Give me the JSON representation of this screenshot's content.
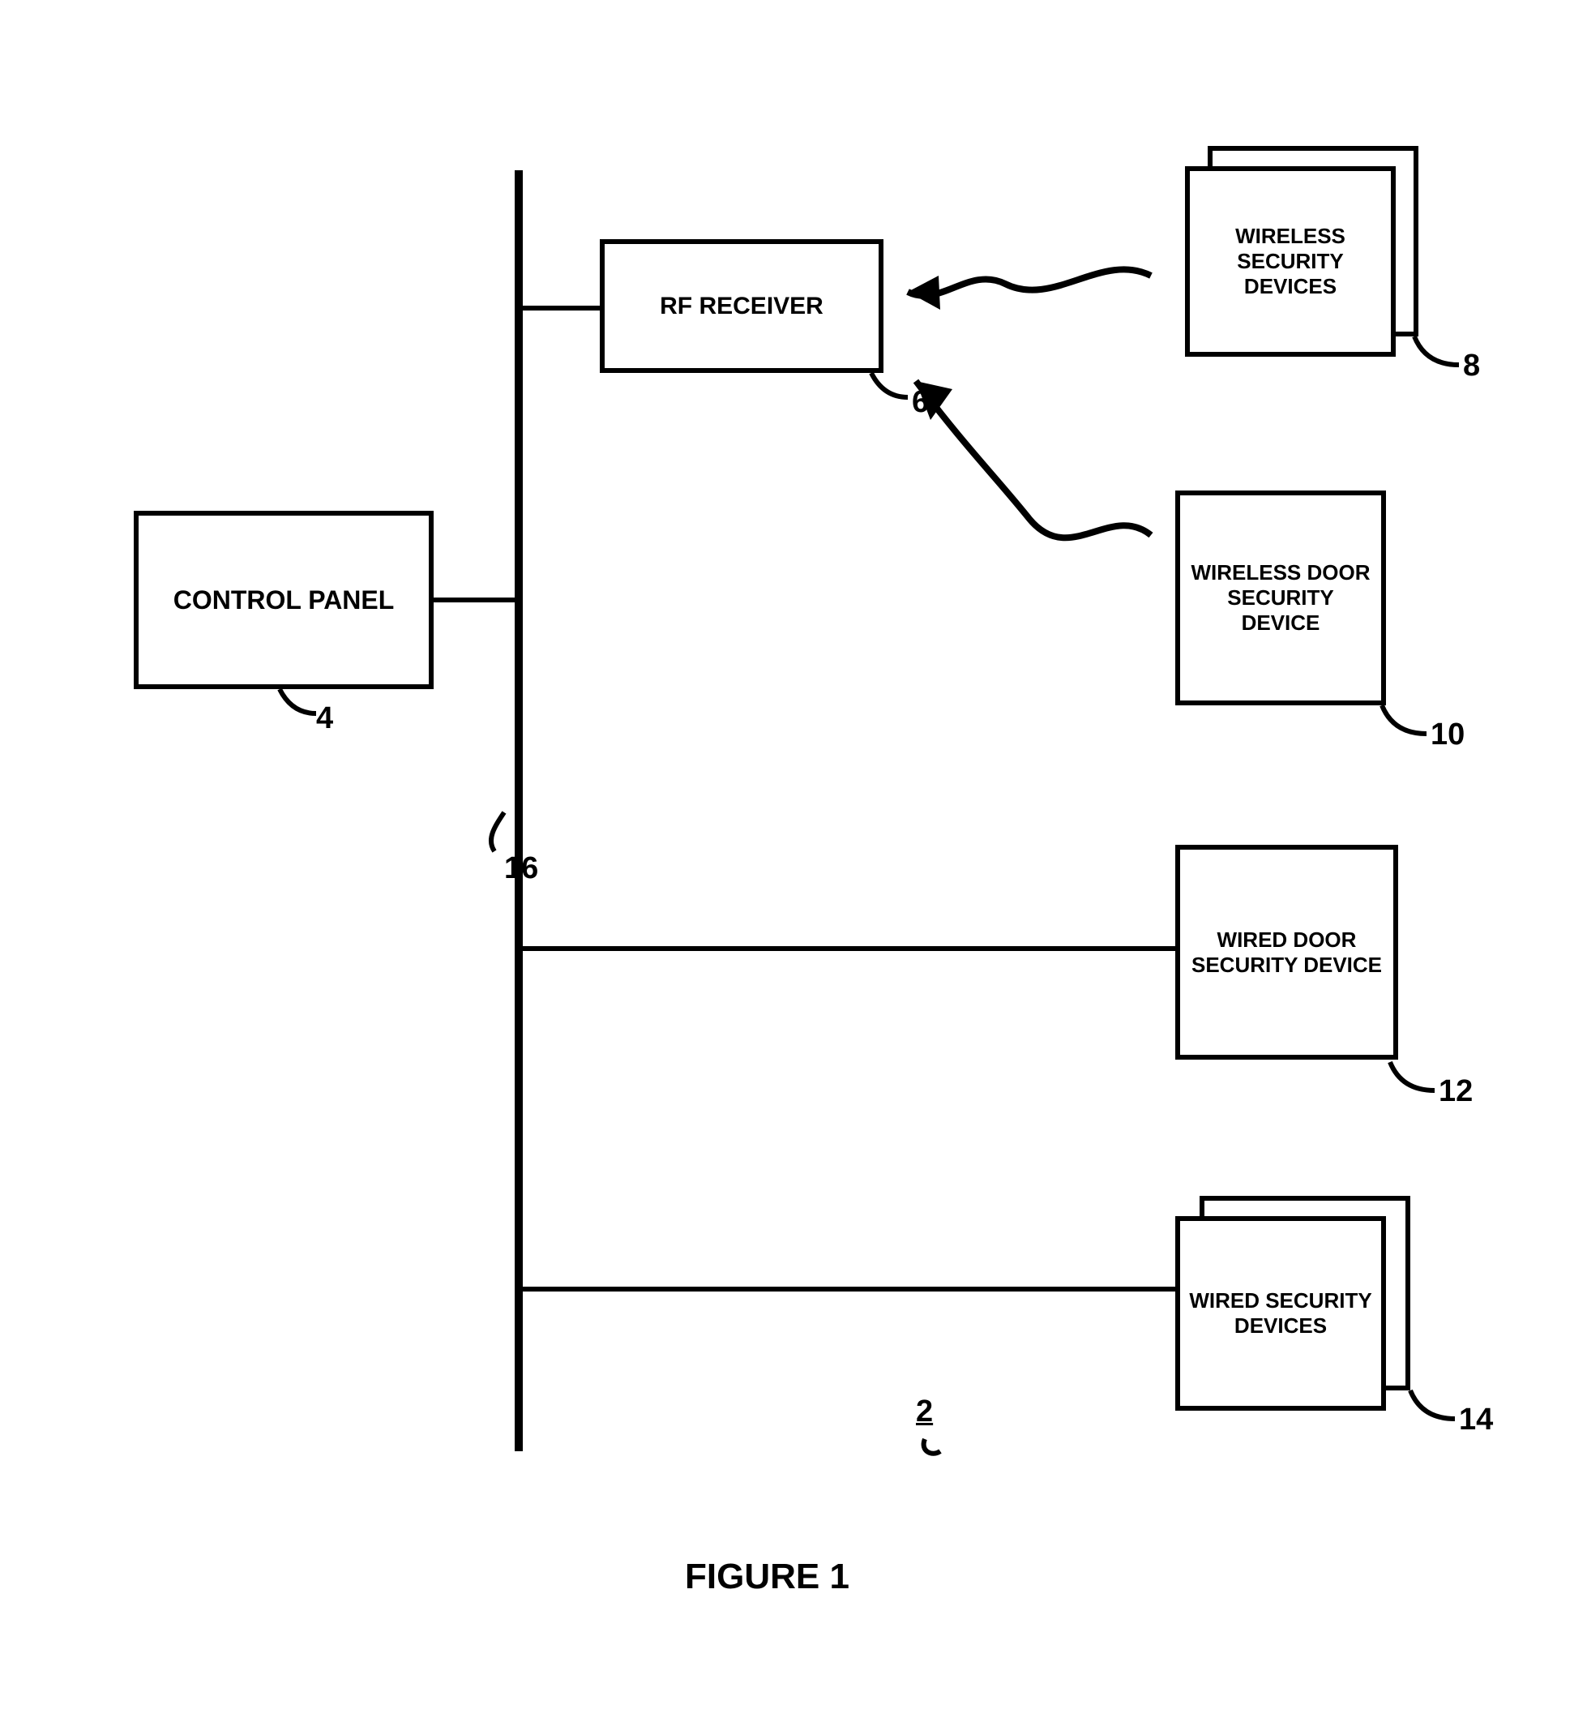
{
  "boxes": {
    "control_panel": "CONTROL PANEL",
    "rf_receiver": "RF RECEIVER",
    "wireless_security_devices": "WIRELESS SECURITY DEVICES",
    "wireless_door_security_device": "WIRELESS DOOR SECURITY DEVICE",
    "wired_door_security_device": "WIRED DOOR SECURITY DEVICE",
    "wired_security_devices": "WIRED SECURITY DEVICES"
  },
  "refnums": {
    "control_panel": "4",
    "rf_receiver": "6",
    "wireless_security_devices": "8",
    "wireless_door_security_device": "10",
    "wired_door_security_device": "12",
    "wired_security_devices": "14",
    "bus": "16",
    "system": "2"
  },
  "figure_title": "FIGURE 1"
}
